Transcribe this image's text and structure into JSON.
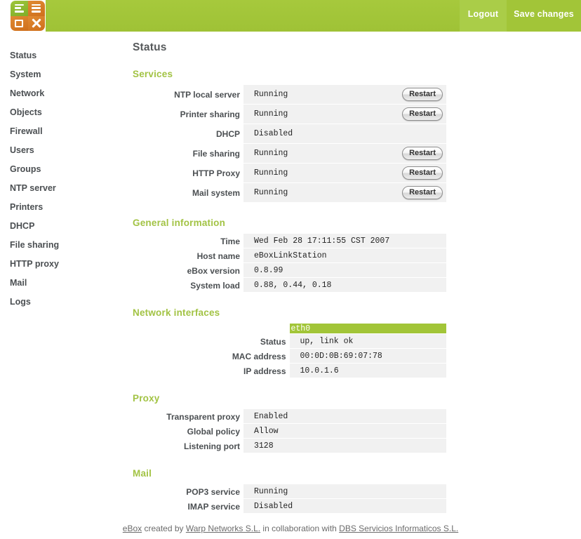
{
  "header": {
    "logo_alt": "eBox",
    "logout_label": "Logout",
    "save_label": "Save changes",
    "brand_green": "#a2c538",
    "brand_orange": "#d9801f"
  },
  "sidebar": {
    "items": [
      {
        "label": "Status"
      },
      {
        "label": "System"
      },
      {
        "label": "Network"
      },
      {
        "label": "Objects"
      },
      {
        "label": "Firewall"
      },
      {
        "label": "Users"
      },
      {
        "label": "Groups"
      },
      {
        "label": "NTP server"
      },
      {
        "label": "Printers"
      },
      {
        "label": "DHCP"
      },
      {
        "label": "File sharing"
      },
      {
        "label": "HTTP proxy"
      },
      {
        "label": "Mail"
      },
      {
        "label": "Logs"
      }
    ]
  },
  "main": {
    "page_title": "Status",
    "sections": {
      "services": {
        "title": "Services",
        "restart_label": "Restart",
        "rows": [
          {
            "label": "NTP local server",
            "value": "Running",
            "action": "Restart"
          },
          {
            "label": "Printer sharing",
            "value": "Running",
            "action": "Restart"
          },
          {
            "label": "DHCP",
            "value": "Disabled",
            "action": ""
          },
          {
            "label": "File sharing",
            "value": "Running",
            "action": "Restart"
          },
          {
            "label": "HTTP Proxy",
            "value": "Running",
            "action": "Restart"
          },
          {
            "label": "Mail system",
            "value": "Running",
            "action": "Restart"
          }
        ]
      },
      "general": {
        "title": "General information",
        "rows": [
          {
            "label": "Time",
            "value": "Wed Feb 28 17:11:55 CST 2007"
          },
          {
            "label": "Host name",
            "value": "eBoxLinkStation"
          },
          {
            "label": "eBox version",
            "value": "0.8.99"
          },
          {
            "label": "System load",
            "value": "0.88, 0.44, 0.18"
          }
        ]
      },
      "network": {
        "title": "Network interfaces",
        "interface_name": "eth0",
        "rows": [
          {
            "label": "Status",
            "value": "up, link ok"
          },
          {
            "label": "MAC address",
            "value": "00:0D:0B:69:07:78"
          },
          {
            "label": "IP address",
            "value": "10.0.1.6"
          }
        ]
      },
      "proxy": {
        "title": "Proxy",
        "rows": [
          {
            "label": "Transparent proxy",
            "value": "Enabled"
          },
          {
            "label": "Global policy",
            "value": "Allow"
          },
          {
            "label": "Listening port",
            "value": "3128"
          }
        ]
      },
      "mail": {
        "title": "Mail",
        "rows": [
          {
            "label": "POP3 service",
            "value": "Running"
          },
          {
            "label": "IMAP service",
            "value": "Disabled"
          }
        ]
      }
    }
  },
  "footer": {
    "link_ebox": "eBox",
    "text_created": " created by ",
    "link_warp": "Warp Networks S.L.",
    "text_collab": " in collaboration with ",
    "link_dbs": "DBS Servicios Informaticos S.L."
  }
}
